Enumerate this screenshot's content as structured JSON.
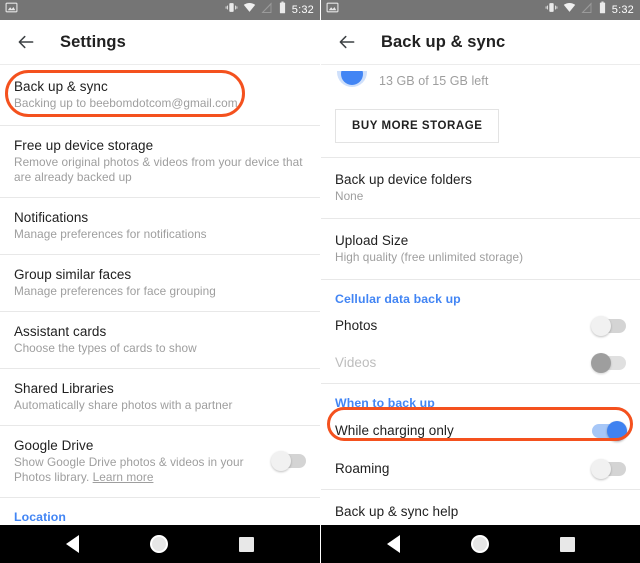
{
  "theme": {
    "accent_blue": "#4285F4",
    "annotation_red": "#F4511E",
    "statusbar_gray": "#757575",
    "navbar_black": "#000000",
    "primary_text": "#212121",
    "secondary_text": "#9E9E9E"
  },
  "status_bar": {
    "notification_icon": "photo-icon",
    "icons": [
      "vibrate-icon",
      "wifi-icon",
      "signal-off-icon",
      "battery-icon"
    ],
    "clock": "5:32"
  },
  "nav_bar": {
    "back": "nav-back-icon",
    "home": "nav-home-icon",
    "recents": "nav-recents-icon"
  },
  "left_screen": {
    "app_bar": {
      "back_icon": "arrow-left-icon",
      "title": "Settings"
    },
    "items": [
      {
        "title": "Back up & sync",
        "subtitle": "Backing up to beebomdotcom@gmail.com",
        "highlighted": true
      },
      {
        "title": "Free up device storage",
        "subtitle": "Remove original photos & videos from your device that are already backed up"
      },
      {
        "title": "Notifications",
        "subtitle": "Manage preferences for notifications"
      },
      {
        "title": "Group similar faces",
        "subtitle": "Manage preferences for face grouping"
      },
      {
        "title": "Assistant cards",
        "subtitle": "Choose the types of cards to show"
      },
      {
        "title": "Shared Libraries",
        "subtitle": "Automatically share photos with a partner"
      },
      {
        "title": "Google Drive",
        "subtitle": "Show Google Drive photos & videos in your Photos library. ",
        "subtitle_link": "Learn more",
        "toggle": "off"
      }
    ],
    "footer_link": "Location"
  },
  "right_screen": {
    "app_bar": {
      "back_icon": "arrow-left-icon",
      "title": "Back up & sync"
    },
    "storage": {
      "text": "13 GB of 15 GB left",
      "buy_button": "BUY MORE STORAGE"
    },
    "items": [
      {
        "title": "Back up device folders",
        "subtitle": "None"
      },
      {
        "title": "Upload Size",
        "subtitle": "High quality (free unlimited storage)"
      }
    ],
    "cellular_section": {
      "header": "Cellular data back up",
      "rows": [
        {
          "title": "Photos",
          "toggle": "off",
          "disabled": false
        },
        {
          "title": "Videos",
          "toggle": "off",
          "disabled": true
        }
      ]
    },
    "when_section": {
      "header": "When to back up",
      "rows": [
        {
          "title": "While charging only",
          "toggle": "on",
          "highlighted": true
        },
        {
          "title": "Roaming",
          "toggle": "off"
        }
      ]
    },
    "help_row": "Back up & sync help"
  }
}
